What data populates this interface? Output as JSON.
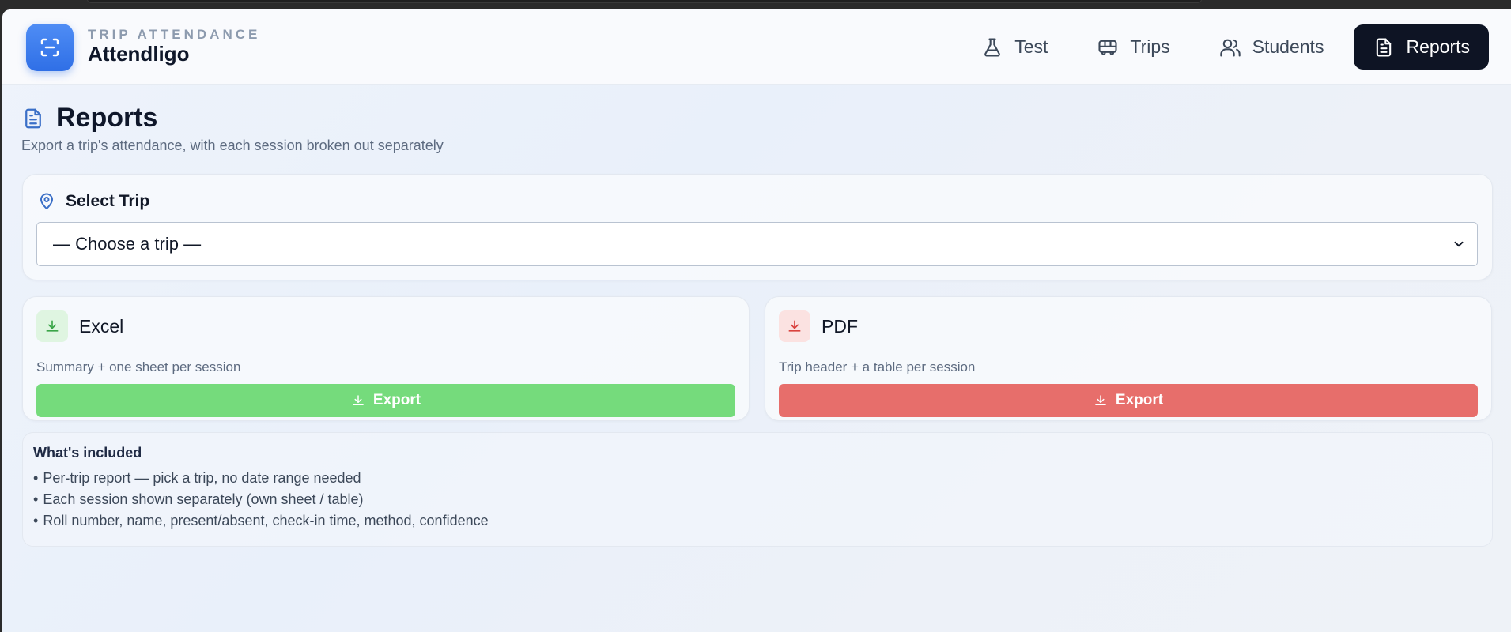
{
  "brand": {
    "kicker": "TRIP ATTENDANCE",
    "name": "Attendligo"
  },
  "nav": {
    "items": [
      {
        "label": "Test",
        "icon": "flask-icon"
      },
      {
        "label": "Trips",
        "icon": "bus-icon"
      },
      {
        "label": "Students",
        "icon": "users-icon"
      },
      {
        "label": "Reports",
        "icon": "document-icon",
        "active": true
      }
    ]
  },
  "page": {
    "title": "Reports",
    "subtitle": "Export a trip's attendance, with each session broken out separately"
  },
  "select_trip": {
    "heading": "Select Trip",
    "value": "— Choose a trip —"
  },
  "exports": {
    "excel": {
      "title": "Excel",
      "description": "Summary + one sheet per session",
      "button": "Export",
      "color": "#75db7c"
    },
    "pdf": {
      "title": "PDF",
      "description": "Trip header + a table per session",
      "button": "Export",
      "color": "#e76e6b"
    }
  },
  "included": {
    "title": "What's included",
    "items": [
      "Per-trip report — pick a trip, no date range needed",
      "Each session shown separately (own sheet / table)",
      "Roll number, name, present/absent, check-in time, method, confidence"
    ]
  },
  "colors": {
    "accent": "#2f6fe6",
    "nav_active_bg": "#0e1424"
  }
}
